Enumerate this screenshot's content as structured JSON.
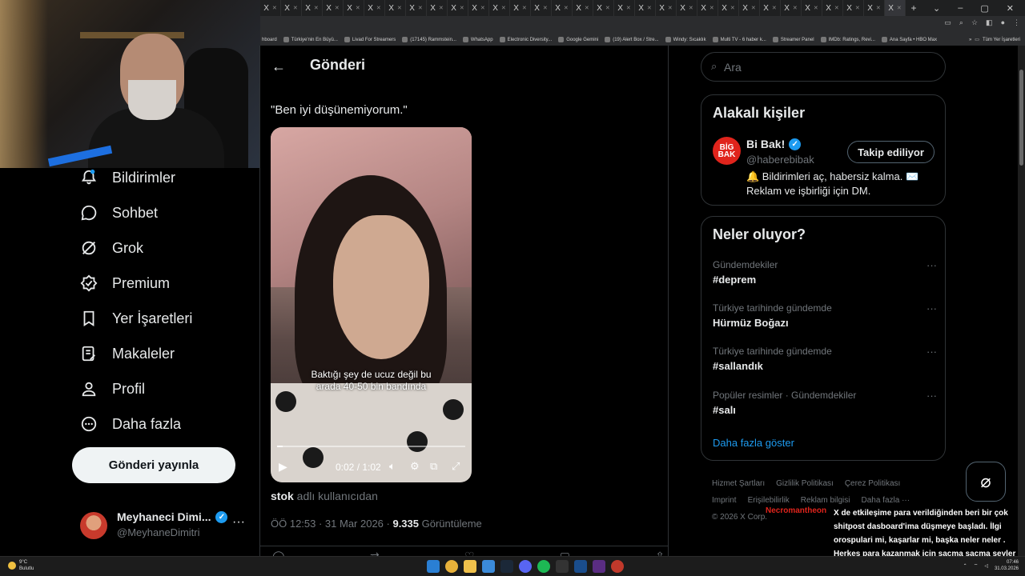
{
  "browser": {
    "tab_glyph": "X",
    "tab_count": 31,
    "new_tab": "+",
    "bookmarks": [
      "hboard",
      "Türkiye'nin En Büyü...",
      "Livad For Streamers",
      "(17145) Rammstein...",
      "WhatsApp",
      "Electronic Diversity...",
      "Google Gemini",
      "(19) Alert Box / Stre...",
      "Windy: Sıcaklık",
      "Multi TV - 6 haber k...",
      "Streamer Panel",
      "IMDb: Ratings, Revi...",
      "Ana Sayfa • HBO Max"
    ],
    "bookmarks_more": "»",
    "all_bookmarks": "Tüm Yer İşaretleri"
  },
  "nav": {
    "items": [
      {
        "label": "Bildirimler",
        "icon": "bell-icon"
      },
      {
        "label": "Sohbet",
        "icon": "chat-icon"
      },
      {
        "label": "Grok",
        "icon": "grok-icon"
      },
      {
        "label": "Premium",
        "icon": "premium-icon"
      },
      {
        "label": "Yer İşaretleri",
        "icon": "bookmark-icon"
      },
      {
        "label": "Makaleler",
        "icon": "article-icon"
      },
      {
        "label": "Profil",
        "icon": "person-icon"
      },
      {
        "label": "Daha fazla",
        "icon": "more-circle-icon"
      }
    ],
    "post_button": "Gönderi yayınla",
    "user_name": "Meyhaneci Dimi...",
    "user_handle": "@MeyhaneDimitri",
    "user_more": "···"
  },
  "post": {
    "header_title": "Gönderi",
    "text": "\"Ben iyi düşünemiyorum.\"",
    "video_caption_line1": "Baktığı şey de ucuz değil bu",
    "video_caption_line2": "arada 40-50 bin bandında",
    "video_time": "0:02 / 1:02",
    "video_progress": 0.03,
    "source_user": "stok",
    "source_suffix": " adlı kullanıcıdan",
    "timestamp": "ÖÖ 12:53 · 31 Mar 2026 · ",
    "views_count": "9.335",
    "views_label": " Görüntüleme"
  },
  "search": {
    "placeholder": "Ara"
  },
  "related": {
    "title": "Alakalı kişiler",
    "avatar_text": "BİG BAK",
    "name": "Bi Bak!",
    "handle": "@haberebibak",
    "follow_label": "Takip ediliyor",
    "bio": "🔔 Bildirimleri aç, habersiz kalma. ✉️ Reklam ve işbirliği için DM."
  },
  "trends": {
    "title": "Neler oluyor?",
    "items": [
      {
        "context": "Gündemdekiler",
        "name": "#deprem"
      },
      {
        "context": "Türkiye tarihinde gündemde",
        "name": "Hürmüz Boğazı"
      },
      {
        "context": "Türkiye tarihinde gündemde",
        "name": "#sallandık"
      },
      {
        "context": "Popüler resimler · Gündemdekiler",
        "name": "#salı"
      }
    ],
    "more_glyph": "···",
    "show_more": "Daha fazla göster"
  },
  "footer": {
    "links": [
      "Hizmet Şartları",
      "Gizlilik Politikası",
      "Çerez Politikası",
      "Imprint",
      "Erişilebilirlik",
      "Reklam bilgisi",
      "Daha fazla ···"
    ],
    "copyright": "© 2026 X Corp."
  },
  "overlay": {
    "chat_user": "Necromantheon",
    "chat_message": "X de etkileşime para verildiğinden beri bir çok shitpost dasboard'ima düşmeye başladı. İlgi orospulari mi, kaşarlar mi, başka neler neler . Herkes para kazanmak için saçma saçma şeyler paylaşıyor"
  },
  "taskbar": {
    "temp": "9°C",
    "weather": "Bulutlu",
    "time": "07:46",
    "date": "31.03.2026"
  },
  "colors": {
    "accent": "#1d9bf0",
    "background": "#000000",
    "text": "#e7e9ea",
    "muted": "#71767b",
    "chat_name": "#e0241c"
  }
}
